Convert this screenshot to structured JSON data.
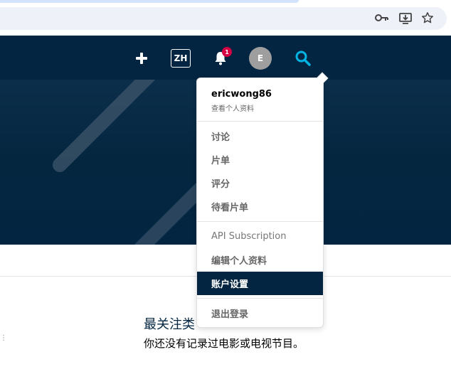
{
  "browser": {
    "icons": [
      "key-icon",
      "install-app-icon",
      "bookmark-star-icon"
    ]
  },
  "header": {
    "add_icon": "plus-icon",
    "language_label": "ZH",
    "notification_count": "1",
    "avatar_initial": "E",
    "search_icon": "search-icon"
  },
  "menu": {
    "username": "ericwong86",
    "view_profile": "查看个人资料",
    "items": [
      {
        "label": "讨论"
      },
      {
        "label": "片单"
      },
      {
        "label": "评分"
      },
      {
        "label": "待看片单"
      },
      {
        "label": "API Subscription"
      },
      {
        "label": "编辑个人资料"
      },
      {
        "label": "账户设置"
      },
      {
        "label": "退出登录"
      }
    ],
    "active_item": "账户设置"
  },
  "main": {
    "most_watched_title": "最关注类",
    "empty_message": "你还没有记录过电影或电视节目。"
  },
  "colors": {
    "header_bg": "#032541",
    "badge": "#d40242",
    "search_accent": "#01b4e4",
    "avatar_bg": "#9e9e9e"
  }
}
